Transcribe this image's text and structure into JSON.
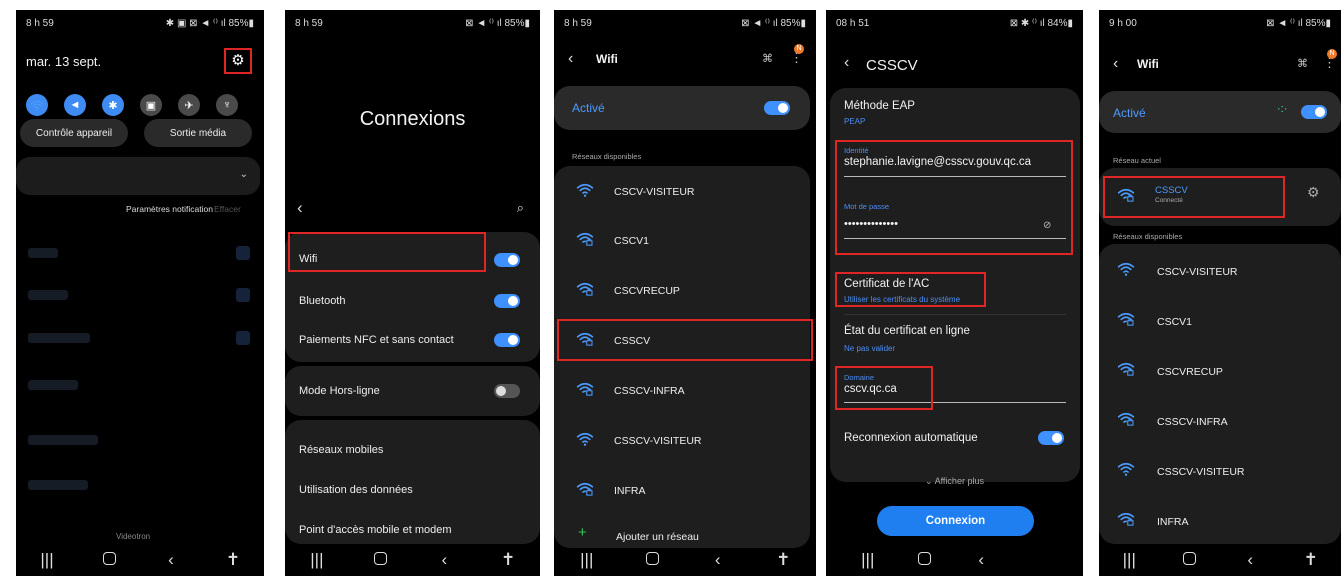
{
  "screen1": {
    "time": "8 h 59",
    "status_right": "✱ ▣ ⊠ ◄ ⁽⁾ ıl 85%▮",
    "date": "mar. 13 sept.",
    "tile_icons": [
      "wifi-icon",
      "sound-icon",
      "bluetooth-icon",
      "orientation-icon",
      "airplane-icon",
      "flashlight-icon"
    ],
    "device_control": "Contrôle appareil",
    "media_output": "Sortie média",
    "notif_settings": "Paramètres notification",
    "clear": "Effacer",
    "carrier": "Videotron"
  },
  "screen2": {
    "time": "8 h 59",
    "status_right": "⊠ ◄ ⁽⁾ ıl 85%▮",
    "title": "Connexions",
    "items": [
      "Wifi",
      "Bluetooth",
      "Paiements NFC et sans contact"
    ],
    "airplane": "Mode Hors-ligne",
    "more": [
      "Réseaux mobiles",
      "Utilisation des données",
      "Point d'accès mobile et modem"
    ]
  },
  "screen3": {
    "time": "8 h 59",
    "status_right": "⊠ ◄ ⁽⁾ ıl 85%▮",
    "title": "Wifi",
    "badge": "N",
    "active": "Activé",
    "section": "Réseaux disponibles",
    "networks": [
      "CSCV-VISITEUR",
      "CSCV1",
      "CSCVRECUP",
      "CSSCV",
      "CSSCV-INFRA",
      "CSSCV-VISITEUR",
      "INFRA"
    ],
    "add": "Ajouter un réseau"
  },
  "screen4": {
    "time": "08 h 51",
    "status_right": "⊠ ✱ ⁽⁾ ıl 84%▮",
    "title": "CSSCV",
    "eap_label": "Méthode EAP",
    "eap_value": "PEAP",
    "identity_label": "Identité",
    "identity_value": "stephanie.lavigne@csscv.gouv.qc.ca",
    "password_label": "Mot de passe",
    "password_value": "••••••••••••••",
    "ca_label": "Certificat de l'AC",
    "ca_value": "Utiliser les certificats du système",
    "online_label": "État du certificat en ligne",
    "online_value": "Ne pas valider",
    "domain_label": "Domaine",
    "domain_value": "cscv.qc.ca",
    "auto_reconnect": "Reconnexion automatique",
    "show_more": "Afficher plus",
    "connect": "Connexion"
  },
  "screen5": {
    "time": "9 h 00",
    "status_right": "⊠ ◄ ⁽⁾ ıl 85%▮",
    "title": "Wifi",
    "badge": "N",
    "active": "Activé",
    "current_section": "Réseau actuel",
    "current_name": "CSSCV",
    "current_status": "Connecté",
    "section": "Réseaux disponibles",
    "networks": [
      "CSCV-VISITEUR",
      "CSCV1",
      "CSCVRECUP",
      "CSSCV-INFRA",
      "CSSCV-VISITEUR",
      "INFRA"
    ]
  },
  "colors": {
    "accent": "#3e91ff",
    "highlight": "#e02525",
    "card": "#1e1e1e"
  }
}
